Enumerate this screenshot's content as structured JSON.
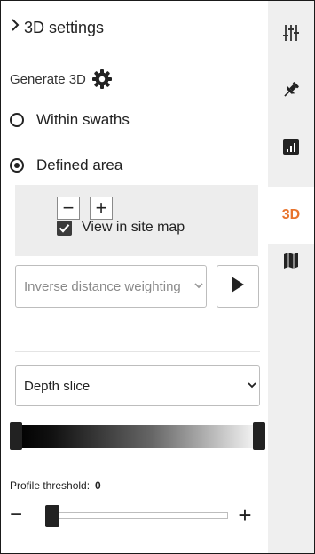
{
  "header": {
    "title": "3D settings",
    "expand_icon": "chevron-right-icon"
  },
  "generate": {
    "label": "Generate 3D",
    "icon": "gear-icon"
  },
  "mode": {
    "options": [
      {
        "label": "Within swaths",
        "selected": false
      },
      {
        "label": "Defined area",
        "selected": true
      }
    ]
  },
  "defined_area": {
    "minus_symbol": "−",
    "plus_symbol": "+",
    "view_in_site_map": {
      "label": "View in site map",
      "checked": true
    }
  },
  "interpolation": {
    "selected": "Inverse distance weighting",
    "play_icon": "play-icon"
  },
  "display": {
    "selected": "Depth slice"
  },
  "profile_threshold": {
    "label": "Profile threshold:",
    "value": "0",
    "minus_symbol": "−",
    "plus_symbol": "+"
  },
  "toolbar": {
    "items": [
      {
        "name": "sliders-icon"
      },
      {
        "name": "pin-icon"
      },
      {
        "name": "bar-chart-icon"
      },
      {
        "label": "3D",
        "active": true
      },
      {
        "name": "map-icon"
      }
    ]
  },
  "colors": {
    "accent": "#e8742d",
    "rail_bg": "#efefef",
    "panel_bg": "#ededed"
  }
}
